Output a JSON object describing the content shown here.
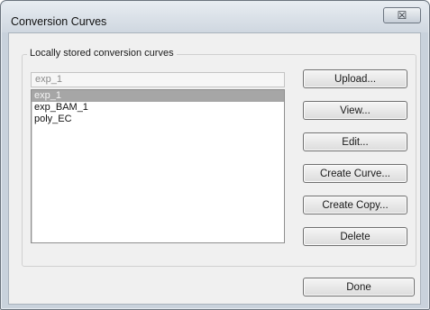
{
  "window": {
    "title": "Conversion Curves",
    "close_glyph": "☒"
  },
  "group": {
    "label": "Locally stored conversion curves"
  },
  "name_field": {
    "value": "exp_1"
  },
  "curve_list": {
    "items": [
      "exp_1",
      "exp_BAM_1",
      "poly_EC"
    ],
    "selected": "exp_1"
  },
  "buttons": {
    "upload": "Upload...",
    "view": "View...",
    "edit": "Edit...",
    "create_curve": "Create Curve...",
    "create_copy": "Create Copy...",
    "delete": "Delete",
    "done": "Done"
  },
  "colors": {
    "selection": "#a6a6a6",
    "client_background": "#f0f0f0",
    "frame": "#c9d2dc"
  }
}
